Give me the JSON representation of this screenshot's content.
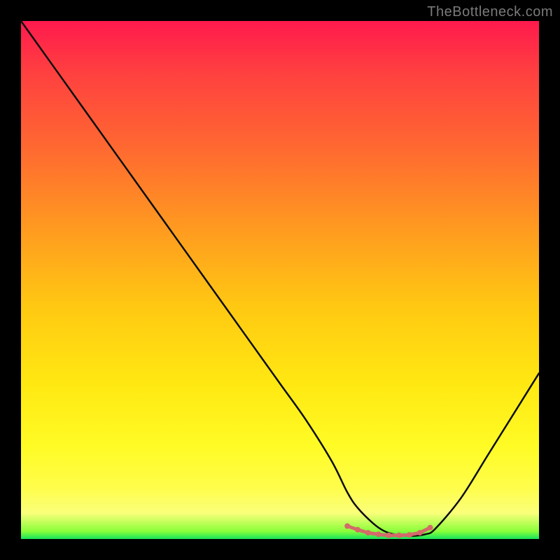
{
  "watermark": "TheBottleneck.com",
  "chart_data": {
    "type": "line",
    "title": "",
    "xlabel": "",
    "ylabel": "",
    "x_range": [
      0,
      100
    ],
    "y_range": [
      0,
      100
    ],
    "grid": false,
    "legend": false,
    "series": [
      {
        "name": "bottleneck-curve",
        "x": [
          0,
          5,
          10,
          15,
          20,
          25,
          30,
          35,
          40,
          45,
          50,
          55,
          60,
          63,
          65,
          68,
          70,
          72,
          75,
          78,
          80,
          85,
          90,
          95,
          100
        ],
        "y": [
          100,
          93,
          86,
          79,
          72,
          65,
          58,
          51,
          44,
          37,
          30,
          23,
          15,
          9,
          6,
          3,
          1.6,
          0.9,
          0.6,
          0.9,
          2,
          8,
          16,
          24,
          32
        ]
      }
    ],
    "highlight_points": {
      "name": "valley-dots",
      "x": [
        63,
        65,
        67,
        69,
        71,
        73,
        75,
        77,
        79
      ],
      "y": [
        2.5,
        1.8,
        1.2,
        0.9,
        0.7,
        0.7,
        0.8,
        1.2,
        2.2
      ]
    },
    "colors": {
      "curve": "#0d0d0d",
      "dots": "#d46a6a",
      "gradient_top": "#ff1a4d",
      "gradient_bottom": "#14e45a"
    }
  }
}
